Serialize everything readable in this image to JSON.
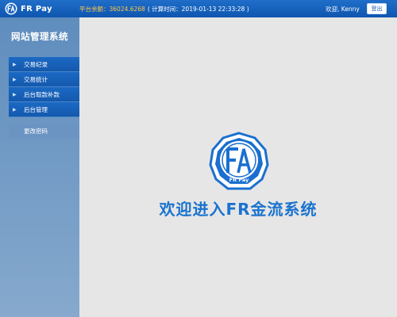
{
  "header": {
    "brand": "FR Pay",
    "balance_label": "平台余额：",
    "balance_value": "36024.6268",
    "timestamp": "( 计算时间：2019-01-13 22:33:28 )",
    "greeting": "欢迎, Kenny",
    "logout_label": "登出"
  },
  "sidebar": {
    "title": "网站管理系统",
    "items": [
      {
        "label": "交易纪录"
      },
      {
        "label": "交易统计"
      },
      {
        "label": "后台取款补款"
      },
      {
        "label": "后台管理"
      }
    ],
    "secondary": {
      "label": "更改密码"
    }
  },
  "main": {
    "emblem_text": "FR Pay",
    "welcome": "欢迎进入FR金流系统"
  },
  "colors": {
    "brand_blue": "#1a73cf",
    "header_blue": "#1565c0",
    "balance_gold": "#ffc64a"
  }
}
